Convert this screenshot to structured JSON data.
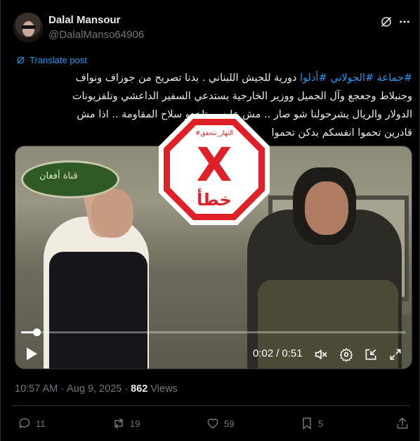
{
  "author": {
    "name": "Dalal Mansour",
    "handle": "@DalalManso64906"
  },
  "translate_label": "Translate post",
  "post": {
    "hashtags": "#جماعة #الجولاني #أذلوا",
    "line1": "دورية للجيش اللبناني . بدنا تصريح من جوزاف ونواف",
    "line2": "وجنبلاط وجعجع وآل الجميل ووزير الخارجية يستدعي السفير الداعشي وتلفزيونات",
    "line3": "الدولار والريال يشرحولنا شو صار .. مش عايزين تاخدو سلاح المقاومة .. اذا مش",
    "line4": "قادرين تحموا انفسكم بدكن تحموا"
  },
  "video": {
    "watermark": "قناة أفغان",
    "current_time": "0:02",
    "separator": "/",
    "duration": "0:51",
    "progress": 0.04
  },
  "stamp": {
    "brand": "#النهار_تتحقق",
    "symbol": "X",
    "verdict": "خطأ",
    "color": "#e01f26"
  },
  "meta": {
    "time": "10:57 AM",
    "dot1": "·",
    "date": "Aug 9, 2025",
    "dot2": "·",
    "views_count": "862",
    "views_label": "Views"
  },
  "actions": {
    "replies": "11",
    "reposts": "19",
    "likes": "59",
    "bookmarks": "5"
  },
  "colors": {
    "background": "#000000",
    "accent": "#1d9bf0",
    "muted": "#71767b",
    "text": "#e7e9ea"
  }
}
